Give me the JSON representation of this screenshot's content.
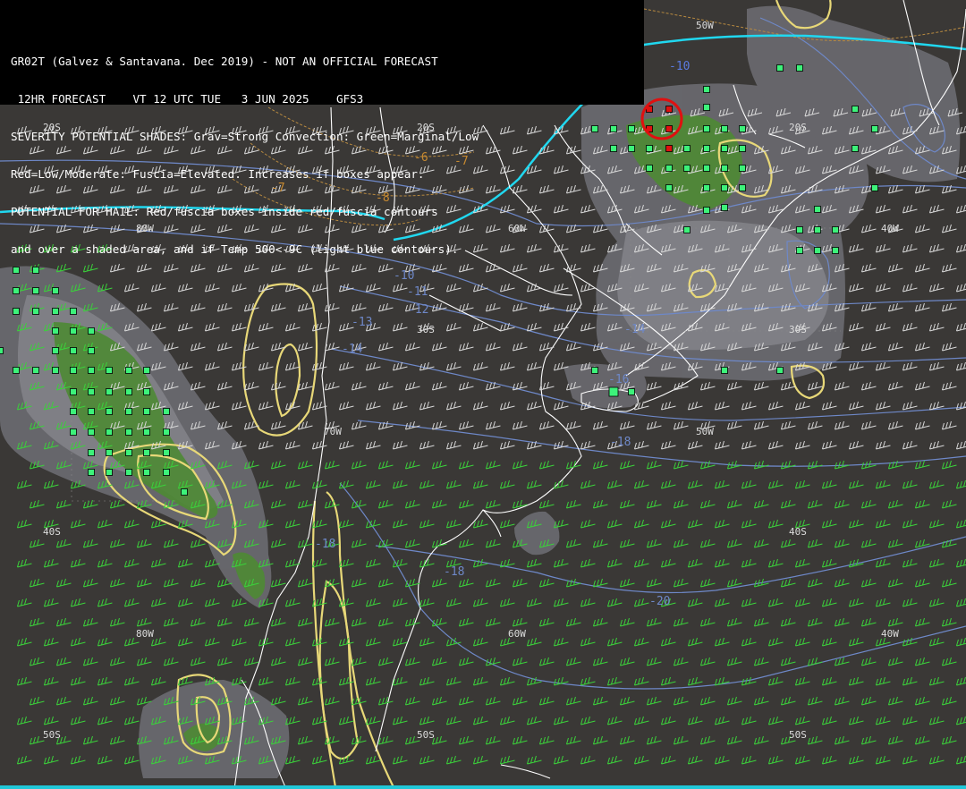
{
  "header": {
    "line1": "GR02T (Galvez & Santavana. Dec 2019) - NOT AN OFFICIAL FORECAST",
    "line2": " 12HR FORECAST    VT 12 UTC TUE   3 JUN 2025    GFS3",
    "line3": "SEVERITY POTENTIAL SHADES: Grav=Strong Convection: Green=Marginal/Low",
    "line4": "Red=Low/Moderate: Fuscia=Elevated. Increases if boxes appear.",
    "line5": "POTENTIAL FOR HAIL: Red/fuscia boxes inside red/fuscia contours",
    "line6": "and over a shaded area, and if Temp 500<-9C (light blue contours)."
  },
  "grid_labels": {
    "lon_50w_top": "50W",
    "lat_20s_west": "20S",
    "lat_20s_center": "20S",
    "lat_20s_east": "20S",
    "lon_80w_north": "80W",
    "lon_60w_north": "60W",
    "lon_40w_north": "40W",
    "lat_30s_center": "30S",
    "lat_30s_east": "30S",
    "lon_70w_mid": "70W",
    "lon_50w_mid": "50W",
    "lat_40s_west": "40S",
    "lat_40s_east": "40S",
    "lon_80w_south": "80W",
    "lon_60w_south": "60W",
    "lon_40w_south": "40W",
    "lat_50s_west": "50S",
    "lat_50s_center": "50S",
    "lat_50s_east": "50S"
  },
  "temp_labels": {
    "t1": "-10",
    "t2": "-6",
    "t3": "-7",
    "t4": "-7",
    "t5": "-8",
    "t6": "-10",
    "t7": "-11",
    "t8": "-12",
    "t9": "-13",
    "t10": "-14",
    "t11": "-14",
    "t12": "-18",
    "t13": "-18",
    "t14": "-18",
    "t15": "-20",
    "t16": "-16"
  },
  "colors": {
    "background": "#3a3836",
    "shade_gray": "#7a7a80",
    "shade_green": "#4e8a34",
    "box_green": "#3df27a",
    "box_red": "#e01010",
    "contour_yellow": "#e8d878",
    "jet_cyan": "#20d8f0",
    "temp_blue": "#6e88c8",
    "wind_green": "#3ad23a",
    "wind_white": "#d8d8d8"
  },
  "icons": {
    "hail_marker": "red-circle-icon",
    "wind_barb": "wind-barb-icon"
  }
}
